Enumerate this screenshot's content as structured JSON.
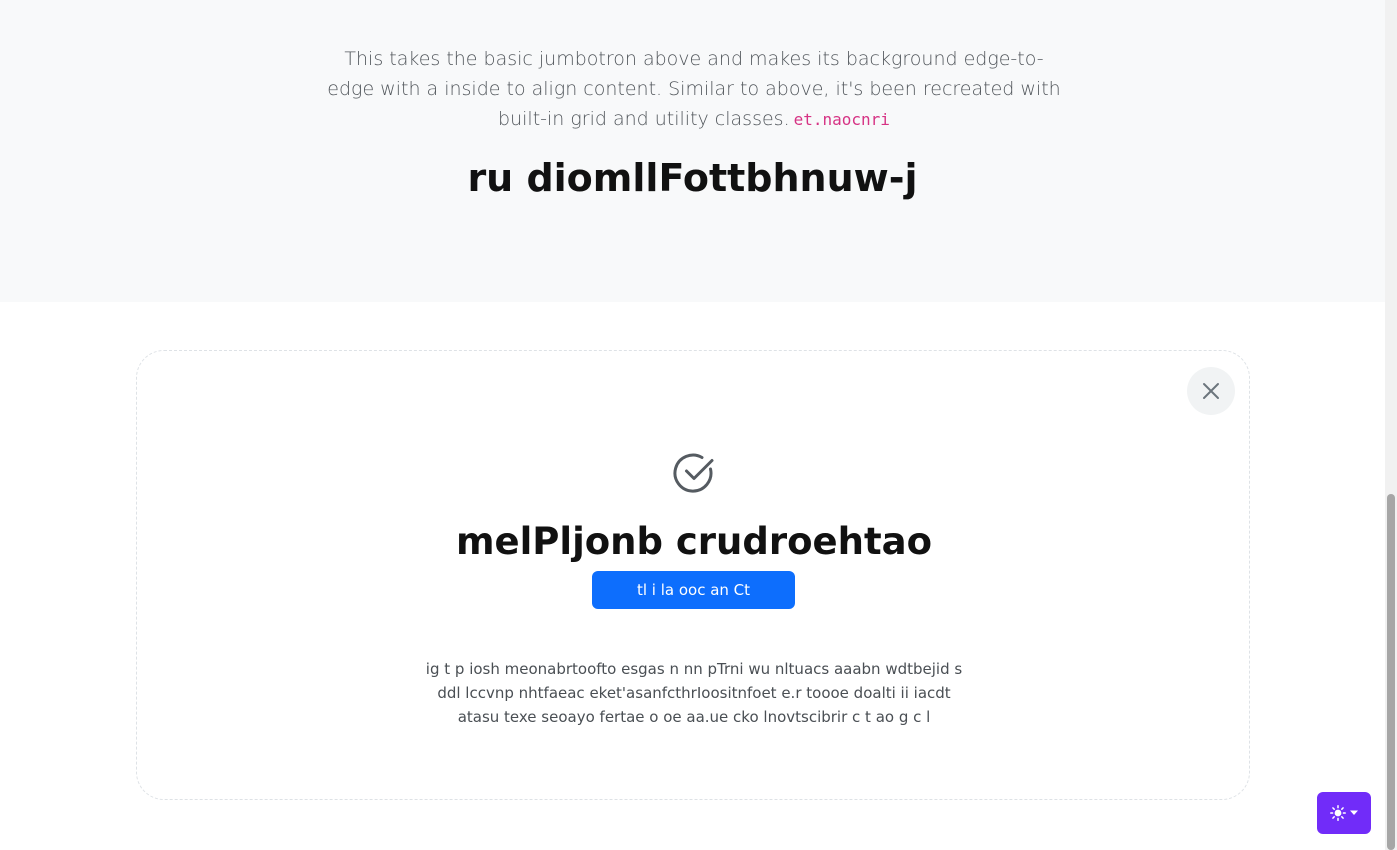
{
  "jumbotron": {
    "lead": "This takes the basic jumbotron above and makes its background edge-to-edge with a inside to align content. Similar to above, it's been recreated with built-in grid and utility classes.",
    "code": "et.naocnri",
    "title": "ru diomllFottbhnuw-j"
  },
  "card": {
    "close_icon": "close-icon",
    "check_icon": "check-circle-icon",
    "title": "melPljonb crudroehtao",
    "button_label": "tl i la ooc an Ct",
    "text_lines": [
      "ig t p iosh meonabrtoofto esgas n nn pTrni wu nltuacs aaabn wdtbejid s",
      "ddl lccvnp nhtfaeac eket'asanfcthrIoositnfoet e.r toooe doalti ii iacdt",
      "atasu texe seoayo fertae o oe aa.ue cko lnovtscibrir c t ao g c l"
    ]
  },
  "theme_toggle": {
    "icon": "sun-icon",
    "caret_icon": "caret-down-icon",
    "color": "#712cf9"
  },
  "colors": {
    "jumbotron_bg": "#f8f9fa",
    "primary": "#0d6efd",
    "code": "#d63384"
  }
}
